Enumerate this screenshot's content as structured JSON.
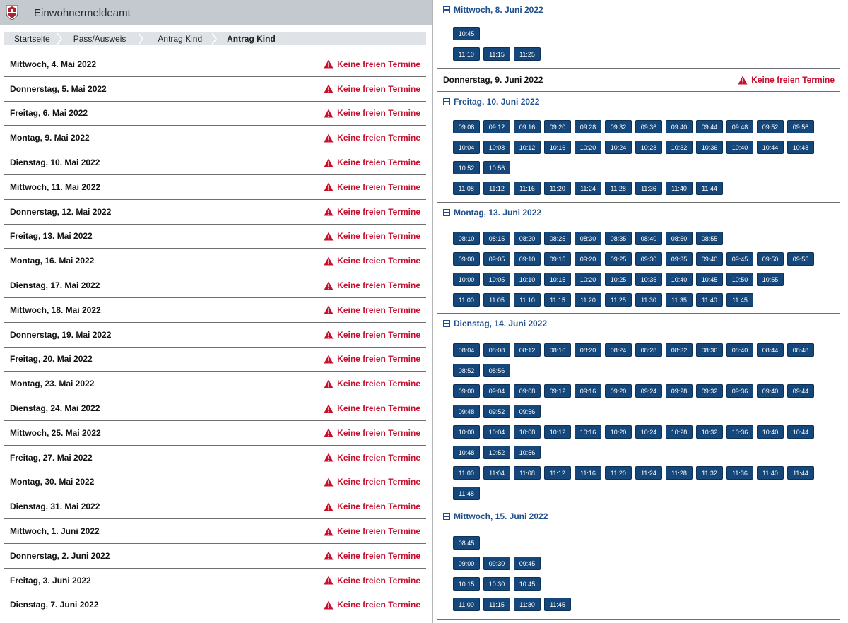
{
  "app": {
    "title": "Einwohnermeldeamt",
    "logo_icon": "coat-of-arms-icon"
  },
  "breadcrumb": [
    "Startseite",
    "Pass/Ausweis",
    "Antrag Kind",
    "Antrag Kind"
  ],
  "status_text": "Keine freien Termine",
  "colors": {
    "accent": "#16477a",
    "warning": "#c8102e",
    "link": "#1f4e8c",
    "header": "#c4c9cf"
  },
  "left_days": [
    "Mittwoch, 4. Mai 2022",
    "Donnerstag, 5. Mai 2022",
    "Freitag, 6. Mai 2022",
    "Montag, 9. Mai 2022",
    "Dienstag, 10. Mai 2022",
    "Mittwoch, 11. Mai 2022",
    "Donnerstag, 12. Mai 2022",
    "Freitag, 13. Mai 2022",
    "Montag, 16. Mai 2022",
    "Dienstag, 17. Mai 2022",
    "Mittwoch, 18. Mai 2022",
    "Donnerstag, 19. Mai 2022",
    "Freitag, 20. Mai 2022",
    "Montag, 23. Mai 2022",
    "Dienstag, 24. Mai 2022",
    "Mittwoch, 25. Mai 2022",
    "Freitag, 27. Mai 2022",
    "Montag, 30. Mai 2022",
    "Dienstag, 31. Mai 2022",
    "Mittwoch, 1. Juni 2022",
    "Donnerstag, 2. Juni 2022",
    "Freitag, 3. Juni 2022",
    "Dienstag, 7. Juni 2022"
  ],
  "right": {
    "mi8": {
      "title": "Mittwoch, 8. Juni 2022",
      "rows": [
        [
          "10:45"
        ],
        [
          "11:10",
          "11:15",
          "11:25"
        ]
      ]
    },
    "do9": {
      "title": "Donnerstag, 9. Juni 2022"
    },
    "fr10": {
      "title": "Freitag, 10. Juni 2022",
      "rows": [
        [
          "09:08",
          "09:12",
          "09:16",
          "09:20",
          "09:28",
          "09:32",
          "09:36",
          "09:40",
          "09:44",
          "09:48",
          "09:52",
          "09:56"
        ],
        [
          "10:04",
          "10:08",
          "10:12",
          "10:16",
          "10:20",
          "10:24",
          "10:28",
          "10:32",
          "10:36",
          "10:40",
          "10:44",
          "10:48"
        ],
        [
          "10:52",
          "10:56"
        ],
        [
          "11:08",
          "11:12",
          "11:16",
          "11:20",
          "11:24",
          "11:28",
          "11:36",
          "11:40",
          "11:44"
        ]
      ]
    },
    "mo13": {
      "title": "Montag, 13. Juni 2022",
      "rows": [
        [
          "08:10",
          "08:15",
          "08:20",
          "08:25",
          "08:30",
          "08:35",
          "08:40",
          "08:50",
          "08:55"
        ],
        [
          "09:00",
          "09:05",
          "09:10",
          "09:15",
          "09:20",
          "09:25",
          "09:30",
          "09:35",
          "09:40",
          "09:45",
          "09:50",
          "09:55"
        ],
        [
          "10:00",
          "10:05",
          "10:10",
          "10:15",
          "10:20",
          "10:25",
          "10:35",
          "10:40",
          "10:45",
          "10:50",
          "10:55"
        ],
        [
          "11:00",
          "11:05",
          "11:10",
          "11:15",
          "11:20",
          "11:25",
          "11:30",
          "11:35",
          "11:40",
          "11:45"
        ]
      ]
    },
    "di14": {
      "title": "Dienstag, 14. Juni 2022",
      "rows": [
        [
          "08:04",
          "08:08",
          "08:12",
          "08:16",
          "08:20",
          "08:24",
          "08:28",
          "08:32",
          "08:36",
          "08:40",
          "08:44",
          "08:48"
        ],
        [
          "08:52",
          "08:56"
        ],
        [
          "09:00",
          "09:04",
          "09:08",
          "09:12",
          "09:16",
          "09:20",
          "09:24",
          "09:28",
          "09:32",
          "09:36",
          "09:40",
          "09:44"
        ],
        [
          "09:48",
          "09:52",
          "09:56"
        ],
        [
          "10:00",
          "10:04",
          "10:08",
          "10:12",
          "10:16",
          "10:20",
          "10:24",
          "10:28",
          "10:32",
          "10:36",
          "10:40",
          "10:44"
        ],
        [
          "10:48",
          "10:52",
          "10:56"
        ],
        [
          "11:00",
          "11:04",
          "11:08",
          "11:12",
          "11:16",
          "11:20",
          "11:24",
          "11:28",
          "11:32",
          "11:36",
          "11:40",
          "11:44"
        ],
        [
          "11:48"
        ]
      ]
    },
    "mi15": {
      "title": "Mittwoch, 15. Juni 2022",
      "rows": [
        [
          "08:45"
        ],
        [
          "09:00",
          "09:30",
          "09:45"
        ],
        [
          "10:15",
          "10:30",
          "10:45"
        ],
        [
          "11:00",
          "11:15",
          "11:30",
          "11:45"
        ]
      ]
    }
  }
}
